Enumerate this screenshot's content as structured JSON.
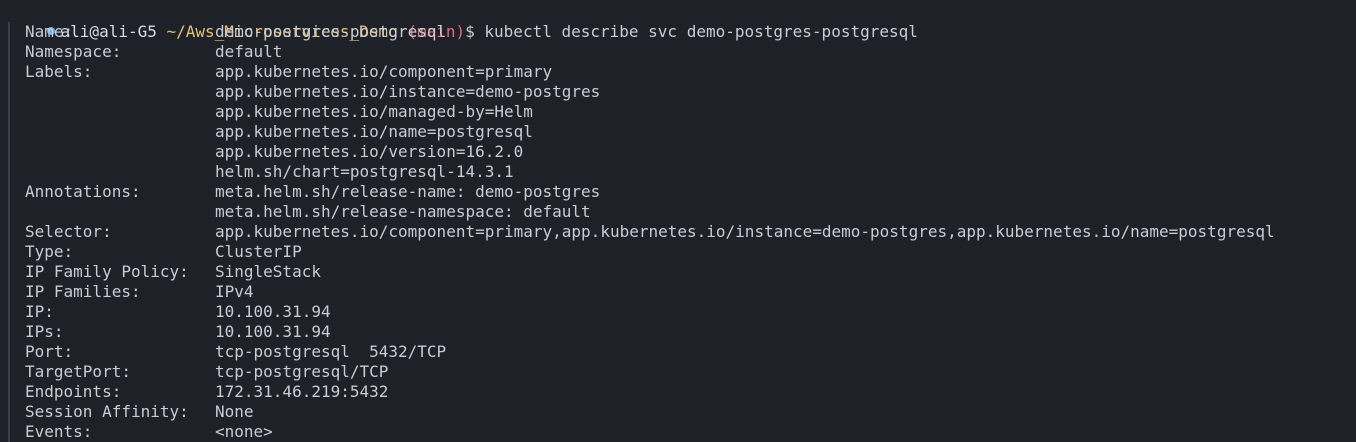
{
  "colors": {
    "background": "#1e2127",
    "text": "#c8ccd4",
    "user_host": "#d6dde6",
    "path": "#e5c07b",
    "branch": "#e06c75",
    "dot": "#61afef"
  },
  "prompt": {
    "status_icon": "filled-circle",
    "user_host": "ali@ali-G5",
    "path": "~/Aws_Microservices_Demo",
    "branch": "(main)",
    "symbol": "$",
    "command": "kubectl describe svc demo-postgres-postgresql"
  },
  "rows": [
    {
      "key": "Name:",
      "value": "demo-postgres-postgresql"
    },
    {
      "key": "Namespace:",
      "value": "default"
    },
    {
      "key": "Labels:",
      "value": "app.kubernetes.io/component=primary"
    },
    {
      "key": "",
      "value": "app.kubernetes.io/instance=demo-postgres"
    },
    {
      "key": "",
      "value": "app.kubernetes.io/managed-by=Helm"
    },
    {
      "key": "",
      "value": "app.kubernetes.io/name=postgresql"
    },
    {
      "key": "",
      "value": "app.kubernetes.io/version=16.2.0"
    },
    {
      "key": "",
      "value": "helm.sh/chart=postgresql-14.3.1"
    },
    {
      "key": "Annotations:",
      "value": "meta.helm.sh/release-name: demo-postgres"
    },
    {
      "key": "",
      "value": "meta.helm.sh/release-namespace: default"
    },
    {
      "key": "Selector:",
      "value": "app.kubernetes.io/component=primary,app.kubernetes.io/instance=demo-postgres,app.kubernetes.io/name=postgresql"
    },
    {
      "key": "Type:",
      "value": "ClusterIP"
    },
    {
      "key": "IP Family Policy:",
      "value": "SingleStack"
    },
    {
      "key": "IP Families:",
      "value": "IPv4"
    },
    {
      "key": "IP:",
      "value": "10.100.31.94"
    },
    {
      "key": "IPs:",
      "value": "10.100.31.94"
    },
    {
      "key": "Port:",
      "value": "tcp-postgresql  5432/TCP"
    },
    {
      "key": "TargetPort:",
      "value": "tcp-postgresql/TCP"
    },
    {
      "key": "Endpoints:",
      "value": "172.31.46.219:5432"
    },
    {
      "key": "Session Affinity:",
      "value": "None"
    },
    {
      "key": "Events:",
      "value": "<none>"
    }
  ]
}
